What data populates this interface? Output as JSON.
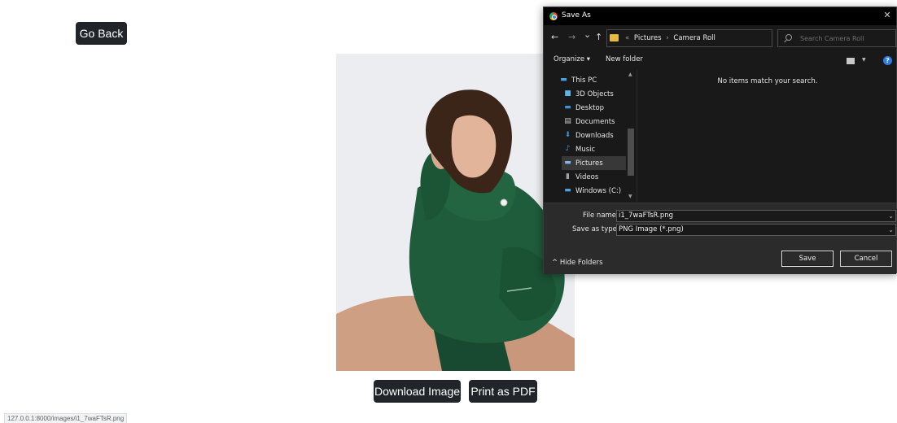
{
  "page": {
    "go_back_label": "Go Back",
    "download_label": "Download Image",
    "print_label": "Print as PDF",
    "status_url": "127.0.0.1:8000/images/i1_7waFTsR.png"
  },
  "dialog": {
    "title": "Save As",
    "close_glyph": "✕",
    "nav": {
      "back_glyph": "←",
      "forward_glyph": "→",
      "recent_glyph": "⌄",
      "up_glyph": "↑",
      "breadcrumb": [
        "«",
        "Pictures",
        "›",
        "Camera Roll"
      ],
      "dropdown_glyph": "⌄",
      "refresh_glyph": "↻",
      "search_placeholder": "Search Camera Roll"
    },
    "toolbar": {
      "organize_label": "Organize ▾",
      "new_folder_label": "New folder",
      "view_chevron": "▼",
      "help_glyph": "?"
    },
    "nav_pane": {
      "items": [
        {
          "label": "This PC",
          "icon": "pc-icon",
          "glyph": "▬",
          "color": "#4aa3df"
        },
        {
          "label": "3D Objects",
          "icon": "cube-icon",
          "glyph": "■",
          "color": "#5fb3e8"
        },
        {
          "label": "Desktop",
          "icon": "desktop-icon",
          "glyph": "▬",
          "color": "#3c8fd8"
        },
        {
          "label": "Documents",
          "icon": "document-icon",
          "glyph": "▤",
          "color": "#c8c8c8"
        },
        {
          "label": "Downloads",
          "icon": "download-icon",
          "glyph": "⬇",
          "color": "#3c8fd8"
        },
        {
          "label": "Music",
          "icon": "music-icon",
          "glyph": "♪",
          "color": "#4aa3df"
        },
        {
          "label": "Pictures",
          "icon": "pictures-icon",
          "glyph": "▬",
          "color": "#7fb6e6"
        },
        {
          "label": "Videos",
          "icon": "videos-icon",
          "glyph": "▮",
          "color": "#9aa0a6"
        },
        {
          "label": "Windows (C:)",
          "icon": "drive-icon",
          "glyph": "▬",
          "color": "#4aa3df"
        }
      ],
      "selected": "Pictures",
      "scroll_up": "▲",
      "scroll_down": "▼"
    },
    "content": {
      "empty_message": "No items match your search."
    },
    "form": {
      "file_name_label": "File name:",
      "file_name_value": "i1_7waFTsR.png",
      "save_type_label": "Save as type:",
      "save_type_value": "PNG Image (*.png)",
      "field_chevron": "⌄",
      "hide_folders_label": "^  Hide Folders",
      "save_label": "Save",
      "cancel_label": "Cancel"
    }
  },
  "colors": {
    "button_bg": "#212529",
    "dialog_bg": "#191919",
    "hoodie": "#1f5c3c"
  }
}
